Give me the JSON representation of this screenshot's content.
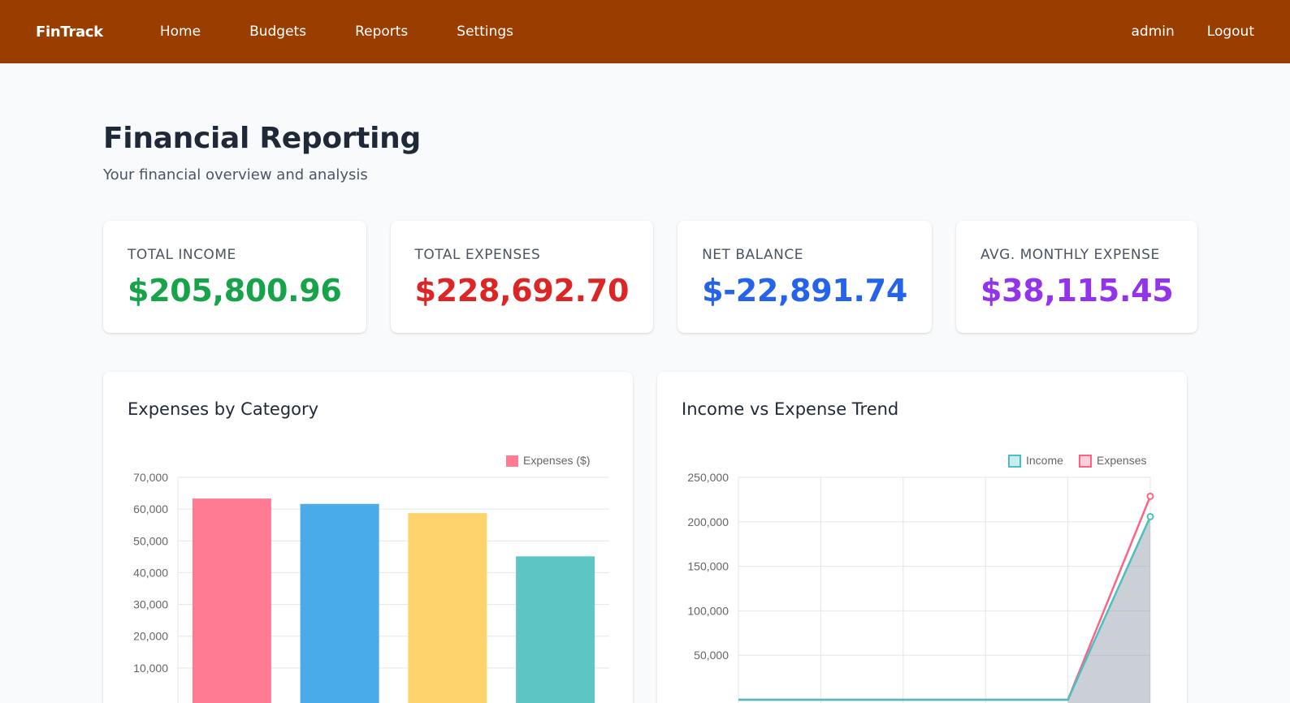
{
  "nav": {
    "brand": "FinTrack",
    "links": [
      "Home",
      "Budgets",
      "Reports",
      "Settings"
    ],
    "user": "admin",
    "logout": "Logout"
  },
  "page": {
    "title": "Financial Reporting",
    "subtitle": "Your financial overview and analysis"
  },
  "stats": [
    {
      "label": "Total Income",
      "value": "$205,800.96",
      "color": "#16a34a"
    },
    {
      "label": "Total Expenses",
      "value": "$228,692.70",
      "color": "#dc2626"
    },
    {
      "label": "Net Balance",
      "value": "$-22,891.74",
      "color": "#2563eb"
    },
    {
      "label": "Avg. Monthly Expense",
      "value": "$38,115.45",
      "color": "#9333ea"
    }
  ],
  "charts": {
    "category_title": "Expenses by Category",
    "trend_title": "Income vs Expense Trend"
  },
  "chart_data": [
    {
      "type": "bar",
      "title": "Expenses by Category",
      "series": [
        {
          "name": "Expenses ($)",
          "values": [
            63200,
            61500,
            58600,
            45000
          ]
        }
      ],
      "colors": [
        "#ff7a93",
        "#4aabeb",
        "#ffd36b",
        "#5ec5c5"
      ],
      "ylim": [
        0,
        70000
      ],
      "yticks": [
        "70,000",
        "60,000",
        "50,000",
        "40,000",
        "30,000",
        "20,000",
        "10,000"
      ],
      "grid": true,
      "legend": "top-right"
    },
    {
      "type": "line",
      "title": "Income vs Expense Trend",
      "series": [
        {
          "name": "Income",
          "values": [
            0,
            0,
            0,
            0,
            0,
            205800.96
          ],
          "color": "#4bc0c0"
        },
        {
          "name": "Expenses",
          "values": [
            0,
            0,
            0,
            0,
            0,
            228692.7
          ],
          "color": "#ff6384"
        }
      ],
      "ylim": [
        0,
        250000
      ],
      "yticks": [
        "250,000",
        "200,000",
        "150,000",
        "100,000",
        "50,000"
      ],
      "grid": true,
      "legend": "top-right"
    }
  ]
}
